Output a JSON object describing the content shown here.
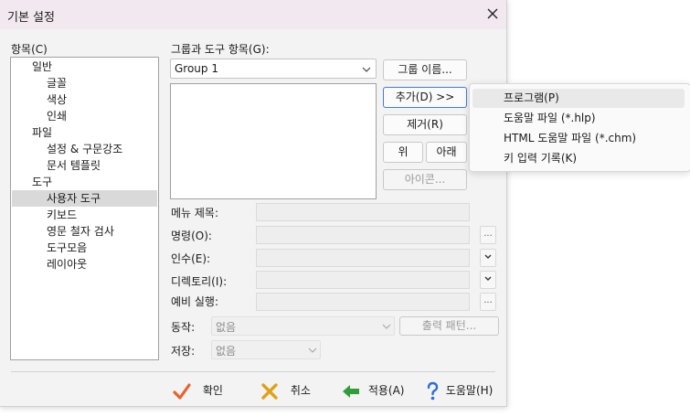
{
  "window": {
    "title": "기본 설정"
  },
  "items_panel": {
    "label": "항목(C)",
    "tree": [
      {
        "label": "일반",
        "level": 0,
        "selected": false
      },
      {
        "label": "글꼴",
        "level": 1,
        "selected": false
      },
      {
        "label": "색상",
        "level": 1,
        "selected": false
      },
      {
        "label": "인쇄",
        "level": 1,
        "selected": false
      },
      {
        "label": "파일",
        "level": 0,
        "selected": false
      },
      {
        "label": "설정 & 구문강조",
        "level": 1,
        "selected": false
      },
      {
        "label": "문서 템플릿",
        "level": 1,
        "selected": false
      },
      {
        "label": "도구",
        "level": 0,
        "selected": false
      },
      {
        "label": "사용자 도구",
        "level": 1,
        "selected": true
      },
      {
        "label": "키보드",
        "level": 1,
        "selected": false
      },
      {
        "label": "영문 철자 검사",
        "level": 1,
        "selected": false
      },
      {
        "label": "도구모음",
        "level": 1,
        "selected": false
      },
      {
        "label": "레이아웃",
        "level": 1,
        "selected": false
      }
    ]
  },
  "group": {
    "label": "그룹과 도구 항목(G):",
    "selected": "Group 1"
  },
  "buttons": {
    "group_name": "그룹 이름...",
    "add": "추가(D) >>",
    "remove": "제거(R)",
    "up": "위",
    "down": "아래",
    "icon": "아이콘..."
  },
  "fields": {
    "menu_title": "메뉴 제목:",
    "command": "명령(O):",
    "argument": "인수(E):",
    "directory": "디렉토리(I):",
    "prerun": "예비 실행:",
    "browse": "...",
    "action_label": "동작:",
    "action_value": "없음",
    "output_pattern": "출력 패턴...",
    "save_label": "저장:",
    "save_value": "없음"
  },
  "dialog_buttons": {
    "ok": "확인",
    "cancel": "취소",
    "apply": "적용(A)",
    "help": "도움말(H)"
  },
  "add_menu": {
    "items": [
      "프로그램(P)",
      "도움말 파일 (*.hlp)",
      "HTML 도움말 파일 (*.chm)",
      "키 입력 기록(K)"
    ],
    "highlighted_index": 0
  },
  "colors": {
    "selection": "#d9d9d9",
    "default_button_border": "#3f7fd4",
    "ok_check": "#e8622c",
    "cancel_x": "#e0a21a",
    "apply_arrow": "#2f9e3a",
    "help_icon": "#2f6fd1"
  }
}
